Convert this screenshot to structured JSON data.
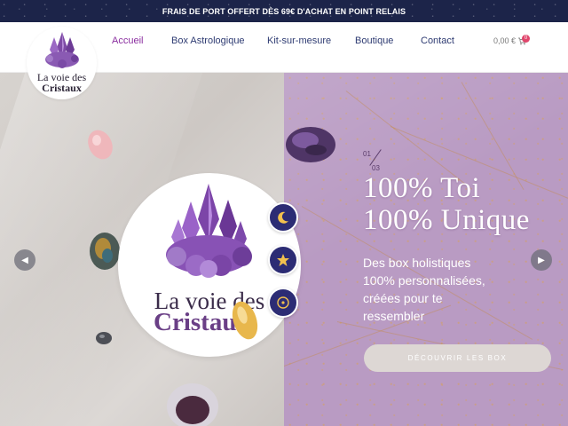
{
  "announcement": {
    "text": "FRAIS DE PORT OFFERT DÈS 69€ D'ACHAT EN POINT RELAIS"
  },
  "logo": {
    "line1": "La voie des",
    "line2": "Cristaux"
  },
  "nav": {
    "items": [
      {
        "label": "Accueil",
        "active": true
      },
      {
        "label": "Box Astrologique",
        "active": false
      },
      {
        "label": "Kit-sur-mesure",
        "active": false
      },
      {
        "label": "Boutique",
        "active": false
      },
      {
        "label": "Contact",
        "active": false
      }
    ]
  },
  "cart": {
    "total": "0,00 €",
    "count": "0"
  },
  "hero": {
    "slide_current": "01",
    "slide_total": "03",
    "headline_line1": "100% Toi",
    "headline_line2": "100% Unique",
    "subtext": "Des box holistiques 100% personnalisées, créées pour te ressembler",
    "cta_label": "DÉCOUVRIR LES BOX",
    "center_logo_line1": "La voie des",
    "center_logo_line2": "Cristaux",
    "feature_icons": [
      "moon-icon",
      "star-icon",
      "sun-icon"
    ]
  },
  "colors": {
    "topbar": "#1c2449",
    "nav_text": "#2e3b72",
    "nav_active": "#8b2fa0",
    "hero_right": "#b99bc3",
    "icon_bg": "#2c2c74",
    "icon_gold": "#f2c14e",
    "cart_badge": "#e0466c"
  }
}
